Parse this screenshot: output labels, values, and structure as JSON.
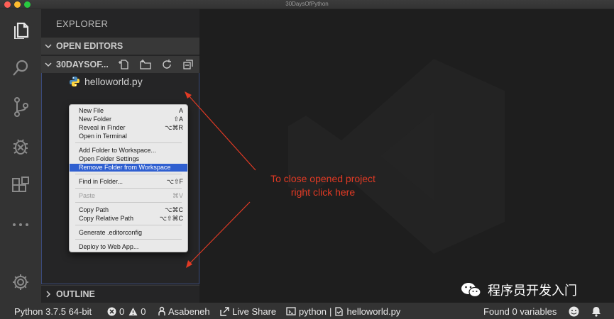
{
  "window": {
    "title": "30DaysOfPython"
  },
  "activity_bar": {
    "items": [
      {
        "icon": "explorer-icon"
      },
      {
        "icon": "search-icon"
      },
      {
        "icon": "source-control-icon"
      },
      {
        "icon": "debug-icon"
      },
      {
        "icon": "extensions-icon"
      },
      {
        "icon": "more-icon"
      }
    ],
    "manage_icon": "gear-icon"
  },
  "sidebar": {
    "title": "EXPLORER",
    "open_editors": "OPEN EDITORS",
    "folder": "30DAYSOF...",
    "files": [
      {
        "name": "helloworld.py",
        "icon": "python-file-icon"
      }
    ],
    "outline": "OUTLINE"
  },
  "context_menu": {
    "items": [
      {
        "label": "New File",
        "shortcut": "A"
      },
      {
        "label": "New Folder",
        "shortcut": "⇧A"
      },
      {
        "label": "Reveal in Finder",
        "shortcut": "⌥⌘R"
      },
      {
        "label": "Open in Terminal",
        "shortcut": ""
      },
      {
        "label": "Add Folder to Workspace...",
        "shortcut": ""
      },
      {
        "label": "Open Folder Settings",
        "shortcut": ""
      },
      {
        "label": "Remove Folder from Workspace",
        "shortcut": "",
        "selected": true
      },
      {
        "label": "Find in Folder...",
        "shortcut": "⌥⇧F"
      },
      {
        "label": "Paste",
        "shortcut": "⌘V",
        "disabled": true
      },
      {
        "label": "Copy Path",
        "shortcut": "⌥⌘C"
      },
      {
        "label": "Copy Relative Path",
        "shortcut": "⌥⇧⌘C"
      },
      {
        "label": "Generate .editorconfig",
        "shortcut": ""
      },
      {
        "label": "Deploy to Web App...",
        "shortcut": ""
      }
    ]
  },
  "annotation": {
    "line1": "To close opened project",
    "line2": "right click here",
    "color": "#e23a24"
  },
  "status_bar": {
    "python": "Python 3.7.5 64-bit",
    "errors": "0",
    "warnings": "0",
    "user": "Asabeneh",
    "live_share": "Live Share",
    "language": "python",
    "file": "helloworld.py",
    "variables": "Found 0 variables"
  },
  "watermark": {
    "text": "程序员开发入门"
  }
}
